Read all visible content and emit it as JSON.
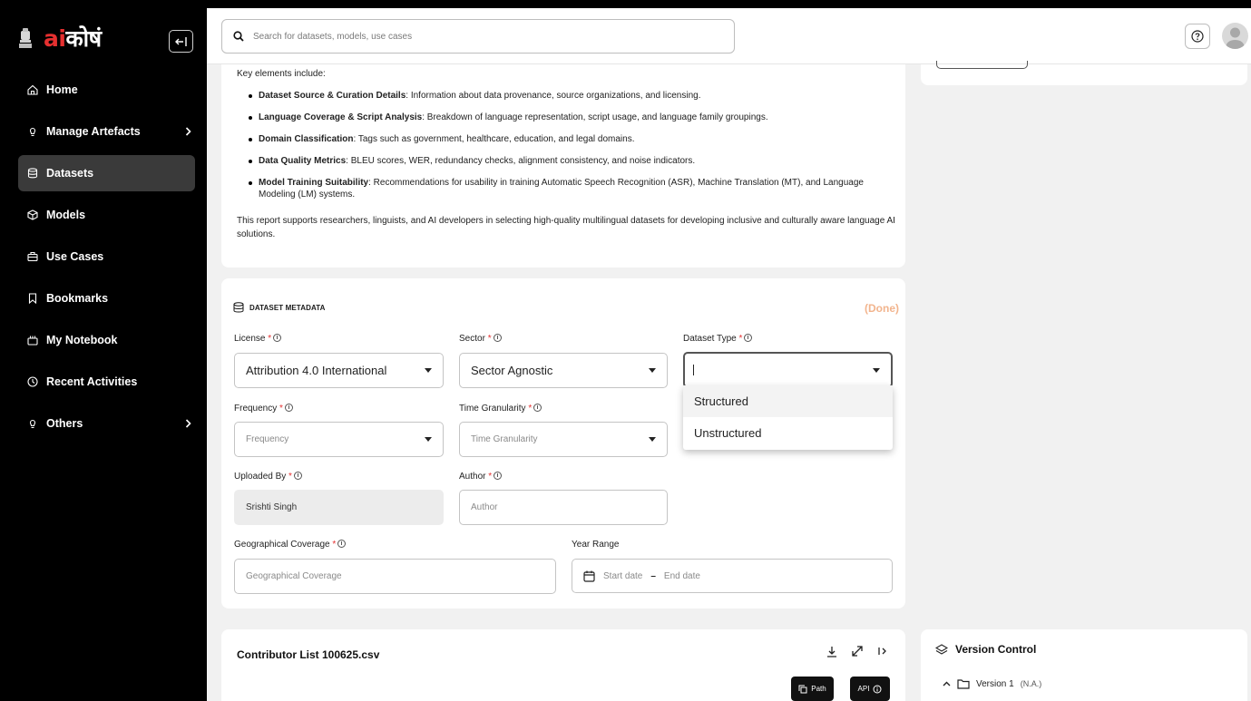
{
  "app": {
    "logo_ai": "ai",
    "logo_kosh": "कोषं"
  },
  "sidebar": {
    "items": [
      {
        "label": "Home",
        "icon": "home-icon",
        "active": false,
        "submenu": false
      },
      {
        "label": "Manage Artefacts",
        "icon": "bulb-icon",
        "active": false,
        "submenu": true
      },
      {
        "label": "Datasets",
        "icon": "database-icon",
        "active": true,
        "submenu": false
      },
      {
        "label": "Models",
        "icon": "cube-icon",
        "active": false,
        "submenu": false
      },
      {
        "label": "Use Cases",
        "icon": "briefcase-icon",
        "active": false,
        "submenu": false
      },
      {
        "label": "Bookmarks",
        "icon": "bookmark-icon",
        "active": false,
        "submenu": false
      },
      {
        "label": "My Notebook",
        "icon": "notebook-icon",
        "active": false,
        "submenu": false
      },
      {
        "label": "Recent Activities",
        "icon": "clock-icon",
        "active": false,
        "submenu": false
      },
      {
        "label": "Others",
        "icon": "bulb-icon",
        "active": false,
        "submenu": true
      }
    ]
  },
  "search": {
    "placeholder": "Search for datasets, models, use cases"
  },
  "description": {
    "intro": "Key elements include:",
    "bullets": [
      {
        "bold": "Dataset Source & Curation Details",
        "text": ": Information about data provenance, source organizations, and licensing."
      },
      {
        "bold": "Language Coverage & Script Analysis",
        "text": ": Breakdown of language representation, script usage, and language family groupings."
      },
      {
        "bold": "Domain Classification",
        "text": ": Tags such as government, healthcare, education, and legal domains."
      },
      {
        "bold": "Data Quality Metrics",
        "text": ": BLEU scores, WER, redundancy checks, alignment consistency, and noise indicators."
      },
      {
        "bold": "Model Training Suitability",
        "text": ": Recommendations for usability in training Automatic Speech Recognition (ASR), Machine Translation (MT), and Language Modeling (LM) systems."
      }
    ],
    "closing": "This report supports researchers, linguists, and AI developers in selecting high-quality multilingual datasets for developing inclusive and culturally aware language AI solutions."
  },
  "metadata": {
    "header": "DATASET METADATA",
    "status": "(Done)",
    "license": {
      "label": "License",
      "value": "Attribution 4.0 International"
    },
    "sector": {
      "label": "Sector",
      "value": "Sector Agnostic"
    },
    "dataset_type": {
      "label": "Dataset Type",
      "value": "",
      "options": [
        "Structured",
        "Unstructured"
      ]
    },
    "frequency": {
      "label": "Frequency",
      "placeholder": "Frequency"
    },
    "time_granularity": {
      "label": "Time Granularity",
      "placeholder": "Time Granularity"
    },
    "uploaded_by": {
      "label": "Uploaded By",
      "value": "Srishti Singh"
    },
    "author": {
      "label": "Author",
      "placeholder": "Author"
    },
    "geo_coverage": {
      "label": "Geographical Coverage",
      "placeholder": "Geographical Coverage"
    },
    "year_range": {
      "label": "Year Range",
      "start_placeholder": "Start date",
      "end_placeholder": "End date",
      "separator": "–"
    },
    "required_mark": "*"
  },
  "contributor": {
    "title": "Contributor List 100625.csv",
    "path_label": "Path",
    "api_label": "API"
  },
  "version_control": {
    "title": "Version Control",
    "version_label": "Version 1",
    "version_note": "(N.A.)"
  }
}
